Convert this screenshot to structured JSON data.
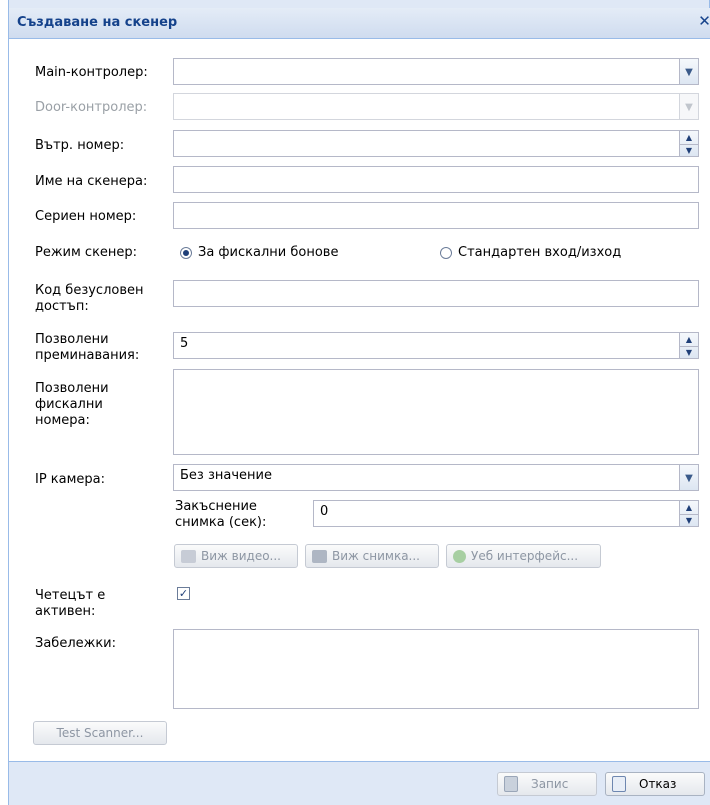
{
  "window": {
    "title": "Създаване на скенер",
    "close_glyph": "✕"
  },
  "labels": {
    "main_controller": "Main-контролер:",
    "door_controller": "Door-контролер:",
    "internal_number": "Вътр. номер:",
    "scanner_name": "Име на скенера:",
    "serial_number": "Сериен номер:",
    "scanner_mode": "Режим скенер:",
    "unconditional_code": "Код безусловен достъп:",
    "allowed_passes": "Позволени преминавания:",
    "allowed_fiscal": "Позволени фискални номера:",
    "ip_camera": "IP камера:",
    "snapshot_delay": "Закъснение снимка (сек):",
    "reader_active": "Четецът е активен:",
    "notes": "Забележки:"
  },
  "fields": {
    "main_controller": "",
    "door_controller": "",
    "internal_number": "",
    "scanner_name": "",
    "serial_number": "",
    "unconditional_code": "",
    "allowed_passes": "5",
    "allowed_fiscal": "",
    "ip_camera": "Без значение",
    "snapshot_delay": "0",
    "notes": ""
  },
  "scanner_mode_options": [
    {
      "label": "За фискални бонове",
      "selected": true
    },
    {
      "label": "Стандартен вход/изход",
      "selected": false
    }
  ],
  "reader_active_checked": true,
  "buttons": {
    "view_video": "Виж видео...",
    "view_snapshot": "Виж снимка...",
    "web_interface": "Уеб интерфейс...",
    "test_scanner": "Test Scanner...",
    "save": "Запис",
    "cancel": "Отказ"
  },
  "icons": {
    "combo_trigger": "chevron-down-icon",
    "spinner": "spinner-arrows-icon",
    "view_video": "user-video-icon",
    "view_snapshot": "camera-icon",
    "web_interface": "globe-icon",
    "save": "floppy-disk-icon",
    "cancel": "cancel-document-icon"
  },
  "colors": {
    "title_text": "#15428b",
    "frame": "#dfe8f6",
    "border": "#99bbe8"
  }
}
